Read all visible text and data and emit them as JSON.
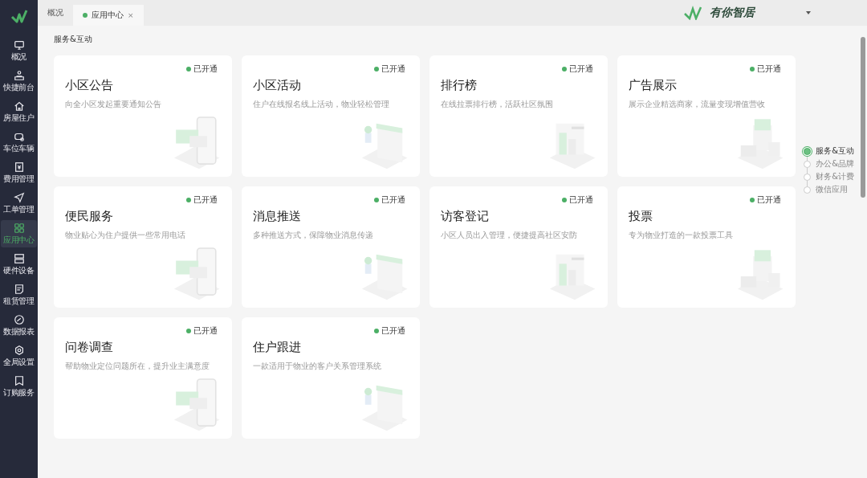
{
  "sidebar": {
    "items": [
      {
        "label": "概况",
        "selected": false
      },
      {
        "label": "快捷前台",
        "selected": false
      },
      {
        "label": "房屋住户",
        "selected": false
      },
      {
        "label": "车位车辆",
        "selected": false
      },
      {
        "label": "费用管理",
        "selected": false
      },
      {
        "label": "工单管理",
        "selected": false
      },
      {
        "label": "应用中心",
        "selected": true
      },
      {
        "label": "硬件设备",
        "selected": false
      },
      {
        "label": "租赁管理",
        "selected": false
      },
      {
        "label": "数据报表",
        "selected": false
      },
      {
        "label": "全局设置",
        "selected": false
      },
      {
        "label": "订购服务",
        "selected": false
      }
    ]
  },
  "tabs": [
    {
      "label": "概况",
      "selected": false
    },
    {
      "label": "应用中心",
      "selected": true,
      "close": "×"
    }
  ],
  "brand": {
    "name": "有你智居"
  },
  "section_title": "服务&互动",
  "cards": [
    {
      "title": "小区公告",
      "description": "向全小区发起重要通知公告",
      "status": "已开通",
      "active": true
    },
    {
      "title": "小区活动",
      "description": "住户在线报名线上活动，物业轻松管理",
      "status": "已开通",
      "active": true
    },
    {
      "title": "排行榜",
      "description": "在线拉票排行榜，活跃社区氛围",
      "status": "已开通",
      "active": true
    },
    {
      "title": "广告展示",
      "description": "展示企业精选商家，流量变现增值营收",
      "status": "已开通",
      "active": true
    },
    {
      "title": "便民服务",
      "description": "物业贴心为住户提供一些常用电话",
      "status": "已开通",
      "active": true
    },
    {
      "title": "消息推送",
      "description": "多种推送方式，保障物业消息传递",
      "status": "已开通",
      "active": true
    },
    {
      "title": "访客登记",
      "description": "小区人员出入管理，便捷提高社区安防",
      "status": "已开通",
      "active": true
    },
    {
      "title": "投票",
      "description": "专为物业打造的一款投票工具",
      "status": "已开通",
      "active": true
    },
    {
      "title": "问卷调查",
      "description": "帮助物业定位问题所在，提升业主满意度",
      "status": "已开通",
      "active": true
    },
    {
      "title": "住户跟进",
      "description": "一款适用于物业的客户关系管理系统",
      "status": "已开通",
      "active": true
    }
  ],
  "stepper": [
    {
      "label": "服务&互动",
      "selected": true
    },
    {
      "label": "办公&品牌",
      "selected": false
    },
    {
      "label": "财务&计费",
      "selected": false
    },
    {
      "label": "微信应用",
      "selected": false
    }
  ]
}
